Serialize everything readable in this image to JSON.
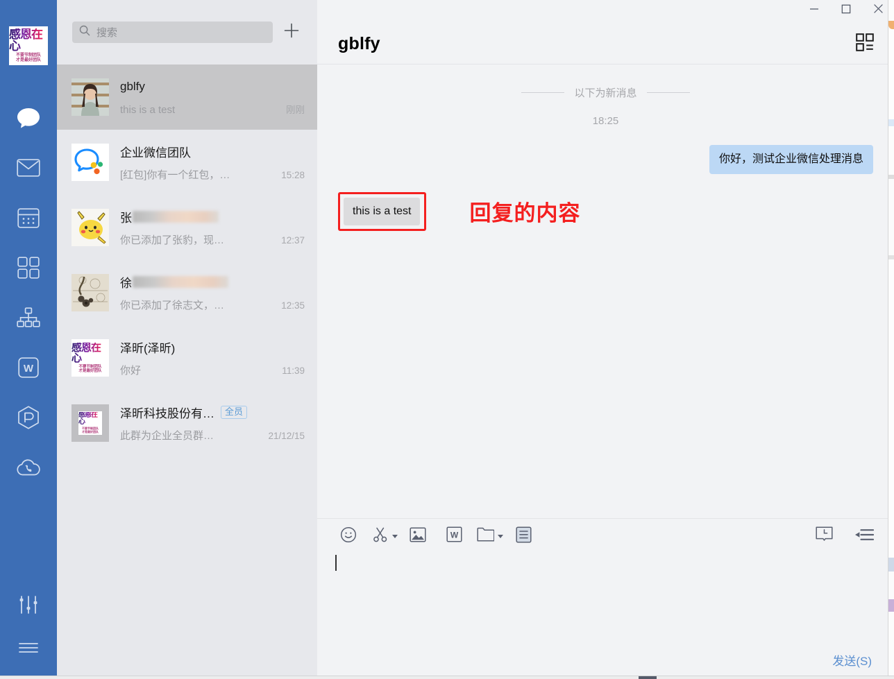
{
  "rail": {
    "avatar": {
      "name": "company-logo",
      "top_text": "感恩在心",
      "bottom_text": "不要节制团队\n才是最好团队"
    },
    "items": [
      {
        "id": "chat",
        "icon": "chat-bubble-icon",
        "label": "消息",
        "active": true
      },
      {
        "id": "mail",
        "icon": "envelope-icon",
        "label": "邮件",
        "active": false
      },
      {
        "id": "calendar",
        "icon": "calendar-icon",
        "label": "日程",
        "active": false
      },
      {
        "id": "workbench",
        "icon": "grid-squares-icon",
        "label": "工作台",
        "active": false
      },
      {
        "id": "contacts",
        "icon": "org-tree-icon",
        "label": "通讯录",
        "active": false
      },
      {
        "id": "documents",
        "icon": "w-document-icon",
        "label": "文档",
        "active": false
      },
      {
        "id": "drive",
        "icon": "cube-icon",
        "label": "微盘",
        "active": false
      },
      {
        "id": "cloud-call",
        "icon": "cloud-phone-icon",
        "label": "云呼叫",
        "active": false
      }
    ],
    "bottom_items": [
      {
        "id": "settings",
        "icon": "sliders-icon",
        "label": "设置"
      },
      {
        "id": "menu",
        "icon": "hamburger-icon",
        "label": "更多"
      }
    ]
  },
  "search": {
    "placeholder": "搜索",
    "icon": "search-icon",
    "value": ""
  },
  "add_button": {
    "icon": "plus-icon",
    "label": "发起会话"
  },
  "conversations": [
    {
      "name": "gblfy",
      "name_blurred": false,
      "preview": "this is a test",
      "time": "刚刚",
      "active": true,
      "badge": null,
      "avatar": "photo-woman-avatar"
    },
    {
      "name": "企业微信团队",
      "name_blurred": false,
      "preview": "[红包]你有一个红包，…",
      "time": "15:28",
      "active": false,
      "badge": null,
      "avatar": "wecom-logo-avatar"
    },
    {
      "name": "张",
      "name_blurred": true,
      "preview": "你已添加了张豹，现…",
      "time": "12:37",
      "active": false,
      "badge": null,
      "avatar": "pikachu-avatar"
    },
    {
      "name": "徐",
      "name_blurred": true,
      "preview": "你已添加了徐志文，…",
      "time": "12:35",
      "active": false,
      "badge": null,
      "avatar": "chain-photo-avatar"
    },
    {
      "name": "泽昕(泽昕)",
      "name_blurred": false,
      "preview": "你好",
      "time": "11:39",
      "active": false,
      "badge": null,
      "avatar": "company-logo-avatar"
    },
    {
      "name": "泽昕科技股份有…",
      "name_blurred": false,
      "preview": "此群为企业全员群…",
      "time": "21/12/15",
      "active": false,
      "badge": "全员",
      "avatar": "group-logo-avatar"
    }
  ],
  "window_controls": {
    "minimize": {
      "icon": "minimize-icon",
      "label": "最小化"
    },
    "maximize": {
      "icon": "maximize-icon",
      "label": "最大化"
    },
    "close": {
      "icon": "close-icon",
      "label": "关闭"
    }
  },
  "chat": {
    "title": "gblfy",
    "panel_toggle": {
      "icon": "grid-panel-icon",
      "label": "聊天工具栏"
    },
    "new_message_divider": "以下为新消息",
    "timestamp": "18:25",
    "messages": [
      {
        "direction": "outgoing",
        "text": "你好，测试企业微信处理消息"
      },
      {
        "direction": "incoming",
        "text": "this is a test",
        "annotated": true
      }
    ],
    "annotation": {
      "text": "回复的内容",
      "color": "#f41f1f"
    }
  },
  "composer": {
    "tools_left": [
      {
        "id": "emoji",
        "icon": "smiley-icon",
        "label": "表情",
        "caret": false
      },
      {
        "id": "screenshot",
        "icon": "scissors-icon",
        "label": "截图",
        "caret": true
      },
      {
        "id": "image",
        "icon": "picture-icon",
        "label": "图片",
        "caret": false
      },
      {
        "id": "doc",
        "icon": "w-document-icon",
        "label": "文档",
        "caret": false
      },
      {
        "id": "file",
        "icon": "folder-icon",
        "label": "文件",
        "caret": true
      },
      {
        "id": "richtext",
        "icon": "lines-doc-icon",
        "label": "聊天记录",
        "caret": false
      }
    ],
    "tools_right": [
      {
        "id": "history",
        "icon": "history-clock-icon",
        "label": "历史消息"
      },
      {
        "id": "shortcuts",
        "icon": "quick-reply-icon",
        "label": "快捷回复"
      }
    ],
    "input_value": "",
    "send_label": "发送(S)"
  },
  "colors": {
    "rail_blue": "#3d6eb5",
    "list_bg": "#e7e8ec",
    "list_active": "#c6c6c8",
    "main_bg": "#f2f3f5",
    "bubble_out": "#bcd8f5",
    "bubble_in": "#dcdcde",
    "annotation_red": "#f41f1f",
    "send_blue": "#5b8fd0",
    "badge_blue": "#5b9bd5"
  }
}
